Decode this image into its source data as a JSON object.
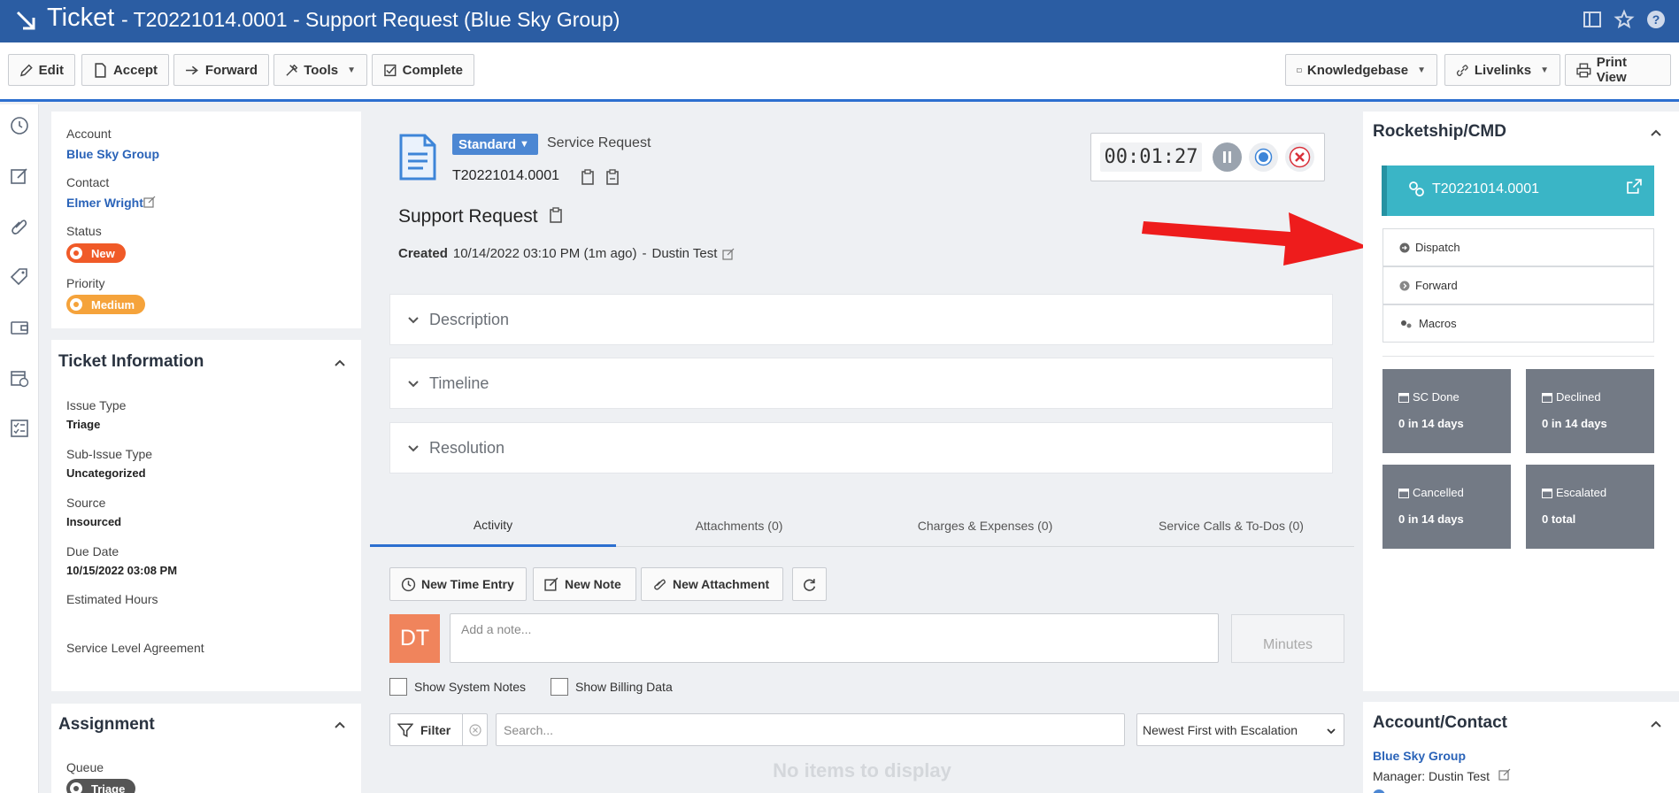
{
  "title_bar": {
    "title": "Ticket",
    "subtitle": "- T20221014.0001 - Support Request (Blue Sky Group)"
  },
  "toolbar": {
    "edit": "Edit",
    "accept": "Accept",
    "forward": "Forward",
    "tools": "Tools",
    "complete": "Complete",
    "knowledgebase": "Knowledgebase",
    "livelinks": "Livelinks",
    "print_view": "Print View"
  },
  "summary": {
    "account_label": "Account",
    "account_value": "Blue Sky Group",
    "contact_label": "Contact",
    "contact_value": "Elmer Wright",
    "status_label": "Status",
    "status_value": "New",
    "priority_label": "Priority",
    "priority_value": "Medium"
  },
  "ticket_info": {
    "title": "Ticket Information",
    "issue_type_label": "Issue Type",
    "issue_type_value": "Triage",
    "sub_issue_label": "Sub-Issue Type",
    "sub_issue_value": "Uncategorized",
    "source_label": "Source",
    "source_value": "Insourced",
    "due_date_label": "Due Date",
    "due_date_value": "10/15/2022 03:08 PM",
    "est_hours_label": "Estimated Hours",
    "sla_label": "Service Level Agreement"
  },
  "assignment": {
    "title": "Assignment",
    "queue_label": "Queue",
    "queue_value": "Triage"
  },
  "header": {
    "category": "Standard",
    "type": "Service Request",
    "ticket_number": "T20221014.0001",
    "title": "Support Request",
    "created_label": "Created",
    "created_value": "10/14/2022 03:10 PM (1m ago)",
    "created_sep": "-",
    "created_by": "Dustin Test"
  },
  "timer": {
    "value": "00:01:27"
  },
  "sections": {
    "description": "Description",
    "timeline": "Timeline",
    "resolution": "Resolution"
  },
  "tabs": {
    "activity": "Activity",
    "attachments": "Attachments (0)",
    "charges": "Charges & Expenses (0)",
    "service_calls": "Service Calls & To-Dos (0)"
  },
  "activity": {
    "new_time_entry": "New Time Entry",
    "new_note": "New Note",
    "new_attachment": "New Attachment",
    "avatar_initials": "DT",
    "note_placeholder": "Add a note...",
    "minutes_placeholder": "Minutes",
    "show_system_notes": "Show System Notes",
    "show_billing_data": "Show Billing Data",
    "filter": "Filter",
    "search_placeholder": "Search...",
    "sort_value": "Newest First with Escalation",
    "empty": "No items to display"
  },
  "rocketship": {
    "title": "Rocketship/CMD",
    "ticket": "T20221014.0001",
    "dispatch": "Dispatch",
    "forward": "Forward",
    "macros": "Macros",
    "tiles": {
      "sc_done_label": "SC Done",
      "sc_done_value": "0 in 14 days",
      "declined_label": "Declined",
      "declined_value": "0 in 14 days",
      "cancelled_label": "Cancelled",
      "cancelled_value": "0 in 14 days",
      "escalated_label": "Escalated",
      "escalated_value": "0 total"
    }
  },
  "account_contact": {
    "title": "Account/Contact",
    "account": "Blue Sky Group",
    "manager": "Manager: Dustin Test"
  },
  "colors": {
    "title_bar": "#2b5da3",
    "status_new": "#f05a28",
    "priority_medium": "#f5a33b",
    "rocketship_ticket": "#3ab5c6",
    "tile": "#737a85",
    "annotation_arrow": "#ee1c1c"
  }
}
